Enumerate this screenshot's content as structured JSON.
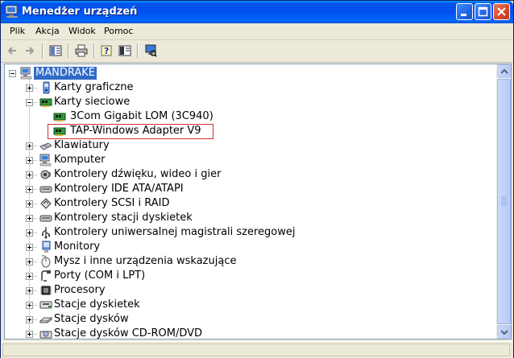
{
  "window": {
    "title": "Menedżer urządzeń",
    "title_icon": "computer-icon",
    "buttons": [
      "minimize-icon",
      "maximize-icon",
      "close-icon"
    ]
  },
  "menu": [
    "Plik",
    "Akcja",
    "Widok",
    "Pomoc"
  ],
  "toolbar": {
    "buttons": [
      "back-arrow-icon",
      "forward-arrow-icon",
      "show-hide-tree-icon",
      "print-icon",
      "help-icon",
      "properties-icon",
      "scan-hardware-icon"
    ]
  },
  "tree": {
    "root": "MANDRAKE",
    "nodes": [
      {
        "label": "Karty graficzne",
        "icon": "display-adapter-icon",
        "expanded": false
      },
      {
        "label": "Karty sieciowe",
        "icon": "network-card-icon",
        "expanded": true,
        "children": [
          {
            "label": "3Com Gigabit LOM (3C940)",
            "icon": "network-card-icon"
          },
          {
            "label": "TAP-Windows Adapter V9",
            "icon": "network-card-icon",
            "highlighted": true
          }
        ]
      },
      {
        "label": "Klawiatury",
        "icon": "keyboard-icon",
        "expanded": false
      },
      {
        "label": "Komputer",
        "icon": "computer-icon",
        "expanded": false
      },
      {
        "label": "Kontrolery dźwięku, wideo i gier",
        "icon": "sound-icon",
        "expanded": false
      },
      {
        "label": "Kontrolery IDE ATA/ATAPI",
        "icon": "ide-controller-icon",
        "expanded": false
      },
      {
        "label": "Kontrolery SCSI i RAID",
        "icon": "scsi-icon",
        "expanded": false
      },
      {
        "label": "Kontrolery stacji dyskietek",
        "icon": "floppy-controller-icon",
        "expanded": false
      },
      {
        "label": "Kontrolery uniwersalnej magistrali szeregowej",
        "icon": "usb-icon",
        "expanded": false
      },
      {
        "label": "Monitory",
        "icon": "monitor-icon",
        "expanded": false
      },
      {
        "label": "Mysz i inne urządzenia wskazujące",
        "icon": "mouse-icon",
        "expanded": false
      },
      {
        "label": "Porty (COM i LPT)",
        "icon": "port-icon",
        "expanded": false
      },
      {
        "label": "Procesory",
        "icon": "processor-icon",
        "expanded": false
      },
      {
        "label": "Stacje dyskietek",
        "icon": "floppy-drive-icon",
        "expanded": false
      },
      {
        "label": "Stacje dysków",
        "icon": "disk-drive-icon",
        "expanded": false
      },
      {
        "label": "Stacje dysków CD-ROM/DVD",
        "icon": "cdrom-icon",
        "expanded": false
      }
    ]
  },
  "colors": {
    "selection": "#316ac5",
    "highlight_box": "#d03030",
    "titlebar": "#0053ee"
  }
}
